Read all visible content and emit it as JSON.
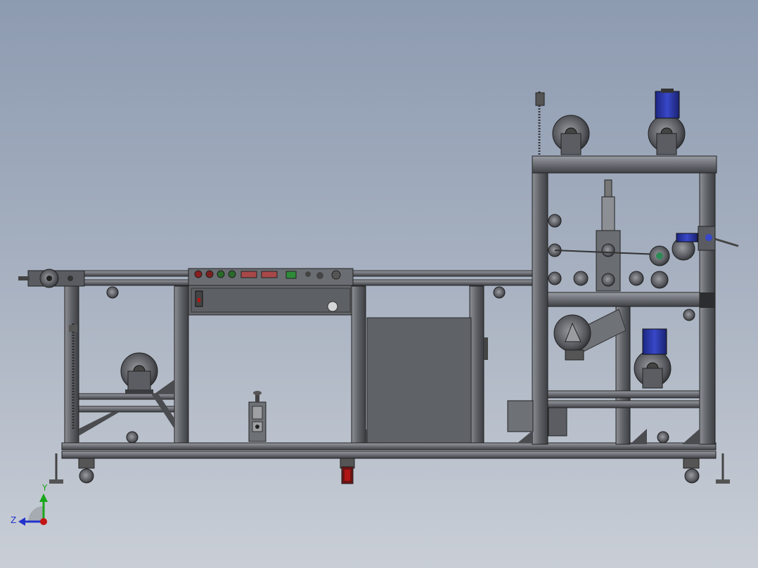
{
  "viewport": {
    "background_top": "#8d9bb1",
    "background_bottom": "#c9ced6",
    "model_steel": "#5c5e63",
    "motor_blue": "#2c3bb0",
    "accent_red": "#b01515"
  },
  "triad": {
    "y_label": "Y",
    "z_label": "Z",
    "x_icon": "x-axis-dot-icon"
  }
}
